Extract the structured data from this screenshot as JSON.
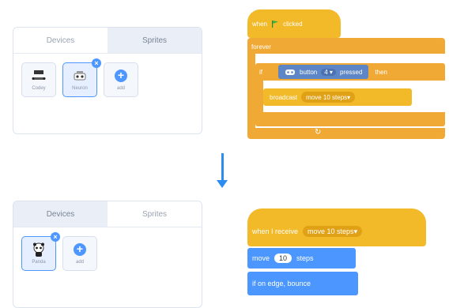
{
  "top_panel": {
    "tabs": [
      {
        "label": "Devices"
      },
      {
        "label": "Sprites"
      }
    ],
    "tiles": [
      {
        "label": "Codey",
        "icon": "codey-robot-icon"
      },
      {
        "label": "Neuron",
        "icon": "neuron-icon"
      },
      {
        "label": "add",
        "icon": "plus-icon"
      }
    ],
    "badge": "×"
  },
  "top_script": {
    "hat": {
      "when": "when",
      "clicked": "clicked"
    },
    "forever": "forever",
    "if_label": "if",
    "sensor": {
      "button": "button",
      "number": "4",
      "pressed": "pressed"
    },
    "then": "then",
    "broadcast": "broadcast",
    "message": "move 10 steps"
  },
  "bottom_panel": {
    "tabs": [
      {
        "label": "Devices"
      },
      {
        "label": "Sprites"
      }
    ],
    "tiles": [
      {
        "label": "Panda",
        "icon": "panda-icon"
      },
      {
        "label": "add",
        "icon": "plus-icon"
      }
    ],
    "badge": "×"
  },
  "bottom_script": {
    "hat": {
      "when_receive": "when I receive",
      "message": "move 10 steps"
    },
    "move": {
      "label": "move",
      "value": "10",
      "unit": "steps"
    },
    "bounce": "if on edge, bounce"
  },
  "colors": {
    "events": "#f2b928",
    "control": "#f1a935",
    "motion": "#4c97ff",
    "sensor": "#5c86c6",
    "accent": "#2d8cf0"
  }
}
